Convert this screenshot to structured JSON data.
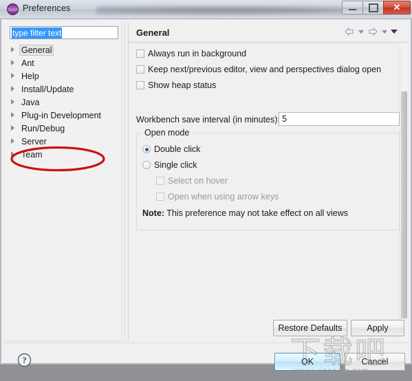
{
  "window": {
    "title": "Preferences",
    "icon": "eclipse-sphere-icon",
    "controls": {
      "minimize_label": "Minimize",
      "maximize_label": "Maximize",
      "close_label": "✕"
    }
  },
  "sidebar": {
    "filter": {
      "value": "type filter text",
      "placeholder": "type filter text",
      "selected": true
    },
    "items": [
      {
        "label": "General",
        "selected": true,
        "expandable": true
      },
      {
        "label": "Ant",
        "selected": false,
        "expandable": true
      },
      {
        "label": "Help",
        "selected": false,
        "expandable": true
      },
      {
        "label": "Install/Update",
        "selected": false,
        "expandable": true
      },
      {
        "label": "Java",
        "selected": false,
        "expandable": true
      },
      {
        "label": "Plug-in Development",
        "selected": false,
        "expandable": true
      },
      {
        "label": "Run/Debug",
        "selected": false,
        "expandable": true
      },
      {
        "label": "Server",
        "selected": false,
        "expandable": true
      },
      {
        "label": "Team",
        "selected": false,
        "expandable": true
      }
    ],
    "annotation": {
      "shape": "ellipse",
      "color": "#cc1111",
      "target": "Server"
    }
  },
  "page": {
    "title": "General",
    "nav": {
      "back_icon": "back-arrow-icon",
      "back_menu_icon": "chevron-down-icon",
      "forward_icon": "forward-arrow-icon",
      "forward_menu_icon": "chevron-down-icon",
      "menu_icon": "chevron-down-icon"
    },
    "checkboxes": [
      {
        "label": "Always run in background",
        "checked": false,
        "enabled": true
      },
      {
        "label": "Keep next/previous editor, view and perspectives dialog open",
        "checked": false,
        "enabled": true
      },
      {
        "label": "Show heap status",
        "checked": false,
        "enabled": true
      }
    ],
    "save_interval": {
      "label": "Workbench save interval (in minutes):",
      "value": "5"
    },
    "open_mode": {
      "legend": "Open mode",
      "radios": [
        {
          "label": "Double click",
          "checked": true
        },
        {
          "label": "Single click",
          "checked": false
        }
      ],
      "sub_checkboxes": [
        {
          "label": "Select on hover",
          "checked": false,
          "enabled": false
        },
        {
          "label": "Open when using arrow keys",
          "checked": false,
          "enabled": false
        }
      ],
      "note_prefix": "Note:",
      "note_text": " This preference may not take effect on all views"
    }
  },
  "buttons": {
    "restore_defaults": "Restore Defaults",
    "apply": "Apply",
    "ok": "OK",
    "cancel": "Cancel",
    "help_icon": "help-question-icon"
  },
  "watermark": {
    "cjk": "下载吧",
    "url": "www.xiazaiba.com"
  },
  "colors": {
    "accent_selection": "#3399ff",
    "annotation_red": "#cc1111",
    "default_button_border": "#3c93c2",
    "panel_bg": "#f0f0f0"
  }
}
